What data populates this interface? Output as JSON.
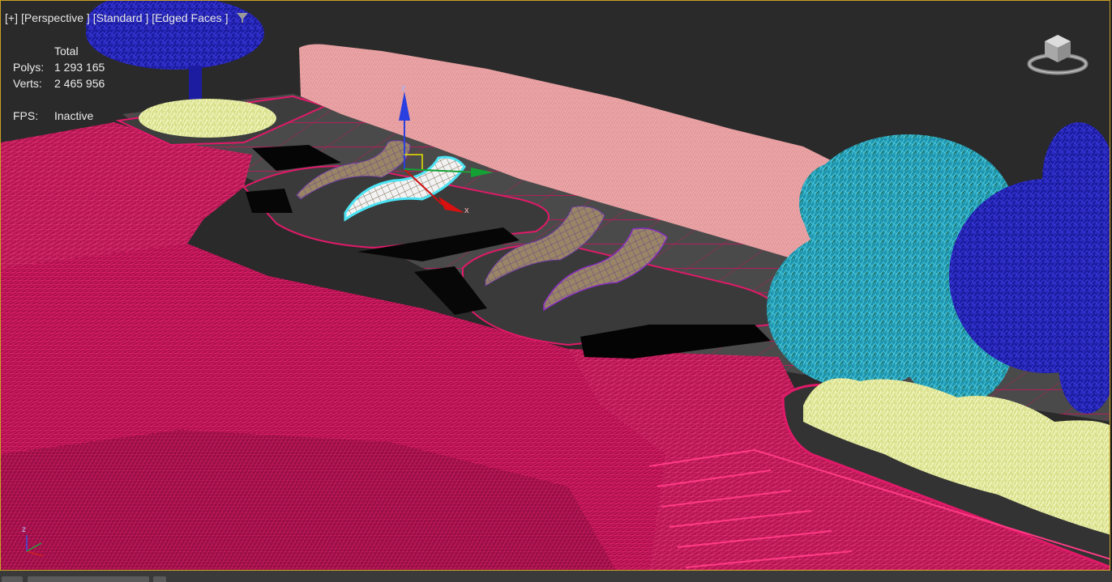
{
  "viewport": {
    "label_plus": "[+]",
    "label_view": "[Perspective ]",
    "label_shading": "[Standard ]",
    "label_edges": "[Edged Faces ]",
    "filter_icon": "filter-icon"
  },
  "stats": {
    "header": "Total",
    "polys_label": "Polys:",
    "polys_value": "1 293 165",
    "verts_label": "Verts:",
    "verts_value": "2 465 956",
    "fps_label": "FPS:",
    "fps_value": "Inactive"
  },
  "gizmo": {
    "z": "z",
    "x": "x"
  },
  "tripod": {
    "z": "z"
  },
  "colors": {
    "viewport_border": "#c9a227",
    "wire_magenta": "#c8145a",
    "hedge": "#e79a9a",
    "tree_cyan": "#2aa6c0",
    "tree_blue": "#2222b0",
    "grass": "#e8eea0"
  },
  "icons": [
    "filter-icon",
    "viewcube-icon",
    "axis-tripod-icon",
    "move-gizmo-icon"
  ]
}
